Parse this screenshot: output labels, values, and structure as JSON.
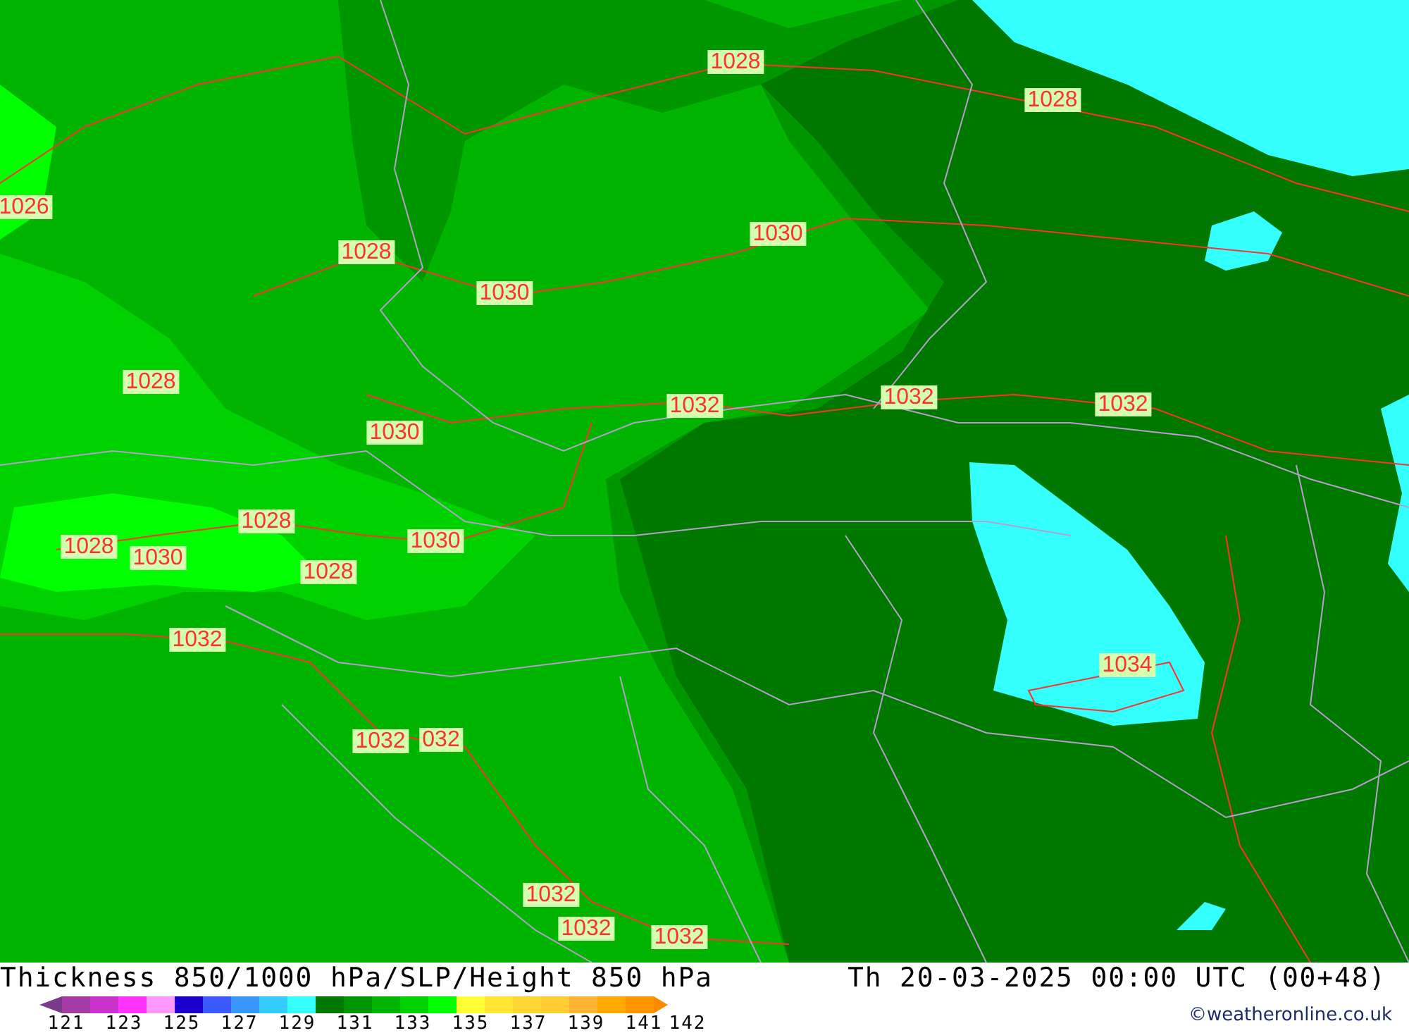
{
  "map": {
    "isobar_labels": [
      {
        "text": "1028"
      },
      {
        "text": "1028"
      },
      {
        "text": "1026"
      },
      {
        "text": "1028"
      },
      {
        "text": "1030"
      },
      {
        "text": "1030"
      },
      {
        "text": "1028"
      },
      {
        "text": "1032"
      },
      {
        "text": "1032"
      },
      {
        "text": "1032"
      },
      {
        "text": "1030"
      },
      {
        "text": "1028"
      },
      {
        "text": "1030"
      },
      {
        "text": "1028"
      },
      {
        "text": "1030"
      },
      {
        "text": "1028"
      },
      {
        "text": "1032"
      },
      {
        "text": "1034"
      },
      {
        "text": "1032"
      },
      {
        "text": "032"
      },
      {
        "text": "1032"
      },
      {
        "text": "1032"
      },
      {
        "text": "1032"
      }
    ]
  },
  "title": "Thickness 850/1000 hPa/SLP/Height 850 hPa",
  "valid_time": "Th 20-03-2025 00:00 UTC (00+48)",
  "legend": {
    "swatches": [
      {
        "kind": "arrow",
        "color": "#7a3a8a"
      },
      {
        "kind": "box",
        "color": "#a43aa4"
      },
      {
        "kind": "box",
        "color": "#cc33cc"
      },
      {
        "kind": "box",
        "color": "#ff33ff"
      },
      {
        "kind": "box",
        "color": "#ff99ff"
      },
      {
        "kind": "box",
        "color": "#1a00cc"
      },
      {
        "kind": "box",
        "color": "#3a5aff"
      },
      {
        "kind": "box",
        "color": "#3a96ff"
      },
      {
        "kind": "box",
        "color": "#33ccff"
      },
      {
        "kind": "box",
        "color": "#33ffff"
      },
      {
        "kind": "box",
        "color": "#007800"
      },
      {
        "kind": "box",
        "color": "#009600"
      },
      {
        "kind": "box",
        "color": "#00b400"
      },
      {
        "kind": "box",
        "color": "#00d200"
      },
      {
        "kind": "box",
        "color": "#00ff00"
      },
      {
        "kind": "box",
        "color": "#ffff33"
      },
      {
        "kind": "box",
        "color": "#ffe633"
      },
      {
        "kind": "box",
        "color": "#ffd633"
      },
      {
        "kind": "box",
        "color": "#ffcc33"
      },
      {
        "kind": "box",
        "color": "#ffb433"
      },
      {
        "kind": "box",
        "color": "#ffaa00"
      },
      {
        "kind": "box",
        "color": "#ff9600"
      },
      {
        "kind": "arrow",
        "color": "#ff8800"
      }
    ],
    "ticks": [
      "121",
      "123",
      "125",
      "127",
      "129",
      "131",
      "133",
      "135",
      "137",
      "139",
      "141",
      "142"
    ]
  },
  "credit": "©weatheronline.co.uk"
}
